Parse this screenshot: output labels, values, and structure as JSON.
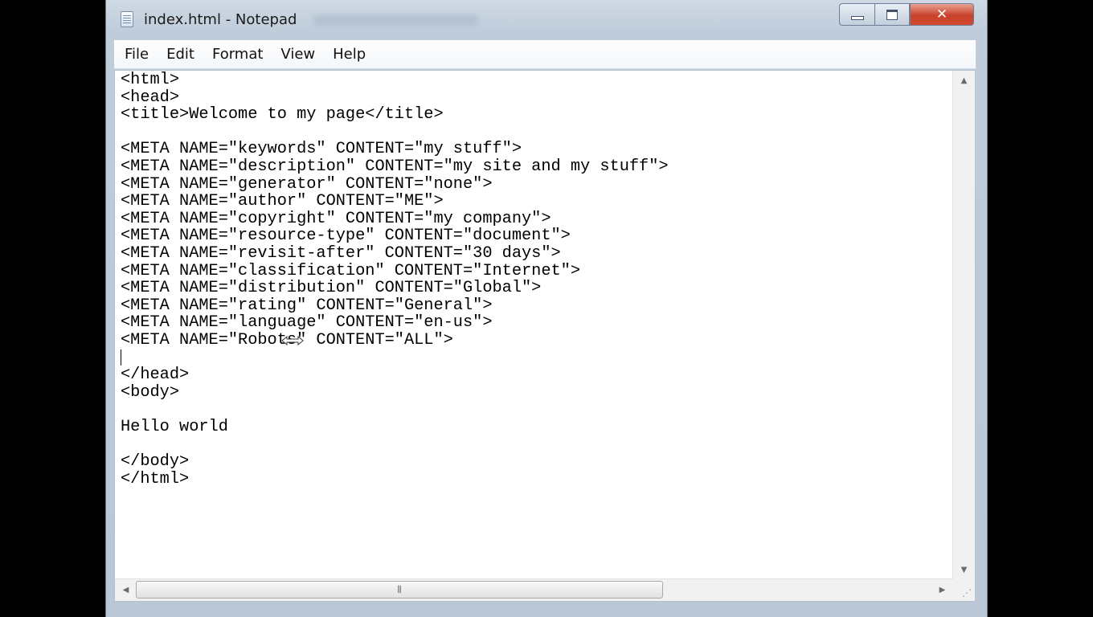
{
  "window": {
    "title": "index.html - Notepad",
    "controls": {
      "minimize": "minimize",
      "maximize": "maximize",
      "close": "✕"
    }
  },
  "menu": {
    "items": [
      {
        "label": "File"
      },
      {
        "label": "Edit"
      },
      {
        "label": "Format"
      },
      {
        "label": "View"
      },
      {
        "label": "Help"
      }
    ]
  },
  "document": {
    "lines": [
      "<html>",
      "<head>",
      "<title>Welcome to my page</title>",
      "",
      "<META NAME=\"keywords\" CONTENT=\"my stuff\">",
      "<META NAME=\"description\" CONTENT=\"my site and my stuff\">",
      "<META NAME=\"generator\" CONTENT=\"none\">",
      "<META NAME=\"author\" CONTENT=\"ME\">",
      "<META NAME=\"copyright\" CONTENT=\"my company\">",
      "<META NAME=\"resource-type\" CONTENT=\"document\">",
      "<META NAME=\"revisit-after\" CONTENT=\"30 days\">",
      "<META NAME=\"classification\" CONTENT=\"Internet\">",
      "<META NAME=\"distribution\" CONTENT=\"Global\">",
      "<META NAME=\"rating\" CONTENT=\"General\">",
      "<META NAME=\"language\" CONTENT=\"en-us\">",
      "<META NAME=\"Robots\" CONTENT=\"ALL\">",
      "",
      "</head>",
      "<body>",
      "",
      "Hello world",
      "",
      "</body>",
      "</html>"
    ]
  },
  "scrollbars": {
    "up": "▲",
    "down": "▼",
    "left": "◀",
    "right": "▶",
    "thumb_grip": "⦀"
  },
  "colors": {
    "close_button": "#c8412b",
    "window_frame": "#bfccda"
  }
}
